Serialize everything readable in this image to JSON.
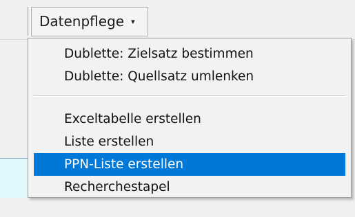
{
  "toolbar": {
    "menu_button_label": "Datenpflege",
    "menu_button_caret": "▾"
  },
  "dropdown": {
    "items": [
      {
        "label": "Dublette: Zielsatz bestimmen",
        "highlighted": false
      },
      {
        "label": "Dublette: Quellsatz umlenken",
        "highlighted": false
      },
      {
        "label": "Exceltabelle erstellen",
        "highlighted": false
      },
      {
        "label": "Liste erstellen",
        "highlighted": false
      },
      {
        "label": "PPN-Liste erstellen",
        "highlighted": true
      },
      {
        "label": "Recherchestapel",
        "highlighted": false
      }
    ]
  },
  "colors": {
    "highlight": "#0078d7",
    "highlight_text": "#ffffff",
    "menu_background": "#f2f2f2"
  }
}
